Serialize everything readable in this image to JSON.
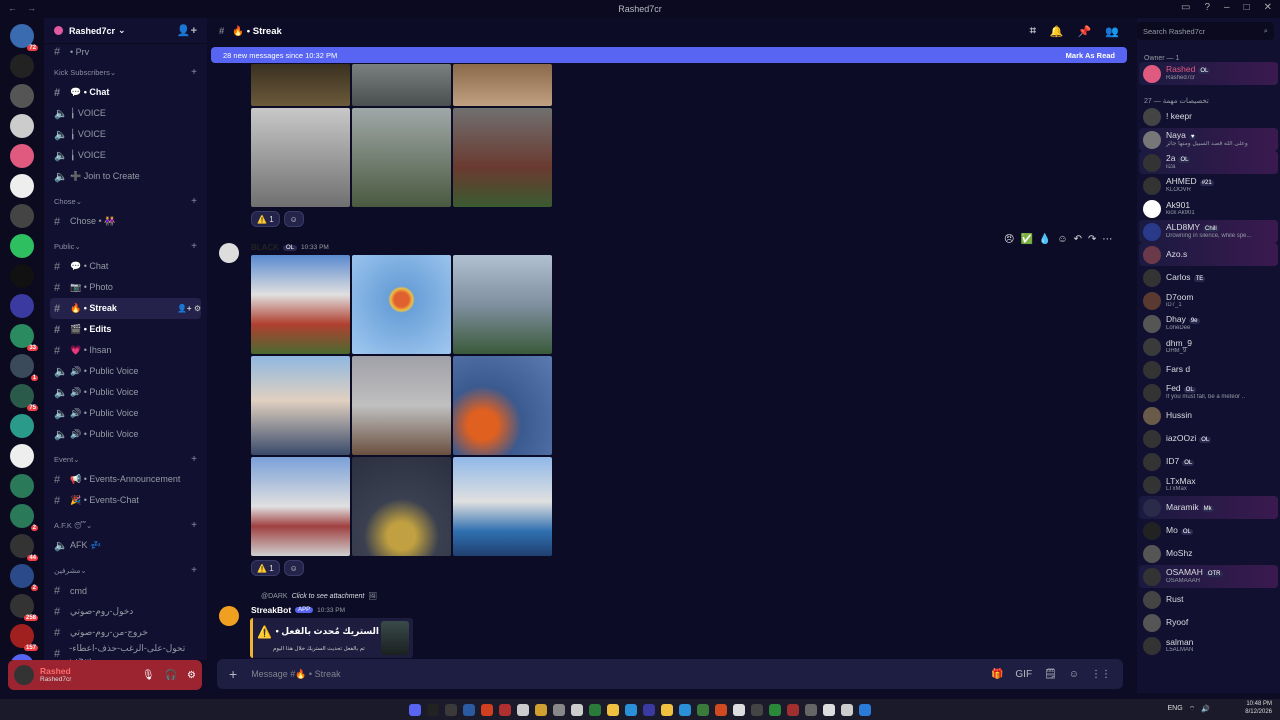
{
  "window": {
    "title": "Rashed7cr",
    "controls": [
      "_",
      "□",
      "×"
    ]
  },
  "server": {
    "name": "Rashed7cr"
  },
  "sidebar": {
    "top_channel": "• Prv",
    "categories": [
      {
        "name": "Kick Subscribers",
        "channels": [
          {
            "icon": "#",
            "label": "💬 • Chat",
            "bold": true
          },
          {
            "icon": "🔊",
            "label": "╽ VOICE"
          },
          {
            "icon": "🔊",
            "label": "╽ VOICE"
          },
          {
            "icon": "🔊",
            "label": "╽ VOICE"
          },
          {
            "icon": "🔊",
            "label": "➕ Join to Create"
          }
        ]
      },
      {
        "name": "Chose",
        "channels": [
          {
            "icon": "#",
            "label": "Chose • 👭"
          }
        ]
      },
      {
        "name": "Public",
        "channels": [
          {
            "icon": "#",
            "label": "💬 • Chat"
          },
          {
            "icon": "#",
            "label": "📷 • Photo"
          },
          {
            "icon": "#",
            "label": "🔥 • Streak",
            "selected": true
          },
          {
            "icon": "#",
            "label": "🎬 • Edits",
            "bold": true
          },
          {
            "icon": "#",
            "label": "💗 • Ihsan"
          },
          {
            "icon": "🔊",
            "label": "🔊 • Public Voice"
          },
          {
            "icon": "🔊",
            "label": "🔊 • Public Voice"
          },
          {
            "icon": "🔊",
            "label": "🔊 • Public Voice"
          },
          {
            "icon": "🔊",
            "label": "🔊 • Public Voice"
          }
        ]
      },
      {
        "name": "Event",
        "channels": [
          {
            "icon": "#",
            "label": "📢 • Events-Announcement"
          },
          {
            "icon": "#",
            "label": "🎉 • Events-Chat"
          }
        ]
      },
      {
        "name": "A.F.K 😴",
        "channels": [
          {
            "icon": "🔊",
            "label": "AFK 💤"
          }
        ]
      },
      {
        "name": "مشرفين",
        "channels": [
          {
            "icon": "#",
            "label": "cmd"
          },
          {
            "icon": "#",
            "label": "دخول-روم-صوتي"
          },
          {
            "icon": "#",
            "label": "خروج-من-روم-صوتي"
          },
          {
            "icon": "#",
            "label": "تحول-على-الرغب-حذف-اعطاء-سحب"
          }
        ]
      }
    ]
  },
  "user_panel": {
    "name": "Rashed",
    "status": "Rashed7cr"
  },
  "channel_header": {
    "name": "🔥 • Streak"
  },
  "banner": {
    "text": "28 new messages since 10:32 PM",
    "action": "Mark As Read"
  },
  "messages": [
    {
      "reaction": "⚠️",
      "count": "1"
    },
    {
      "author": "BLACK",
      "badge": "OL",
      "time": "10:33 PM",
      "reaction": "⚠️",
      "count": "1"
    },
    {
      "reply_to": "@DARK",
      "reply_text": "Click to see attachment",
      "author": "StreakBot",
      "tag": "APP",
      "time": "10:33 PM",
      "embed_title": "الستريك مُحدث بالفعل •",
      "embed_text": "تم بالفعل تحديث الستريك خلال هذا اليوم"
    }
  ],
  "composer": {
    "placeholder": "Message #🔥 • Streak"
  },
  "members": {
    "search": "Search Rashed7cr",
    "groups": [
      {
        "title": "Owner — 1",
        "items": [
          {
            "name": "Rashed",
            "sub": "Rashed7cr",
            "tag": "OL"
          }
        ]
      },
      {
        "title": "27 — تخصيصات مهمة",
        "items": [
          {
            "name": "! keepr",
            "sub": ""
          },
          {
            "name": "Naya",
            "sub": "وعلى الله قصد السبيل ومنها جائر",
            "tag": "♥"
          },
          {
            "name": "2a",
            "sub": "ii2a",
            "tag": "OL"
          },
          {
            "name": "AHMED",
            "sub": "KLOOVR",
            "tag": "#21"
          },
          {
            "name": "Ak901",
            "sub": "kick Ak901"
          },
          {
            "name": "ALD8MY",
            "sub": "Drowning in silence, while spe...",
            "tag": "Chill"
          },
          {
            "name": "Azo.s",
            "sub": ""
          },
          {
            "name": "Carlos",
            "sub": "",
            "tag": "TE"
          },
          {
            "name": "D7oom",
            "sub": "iD7_1"
          },
          {
            "name": "Dhay",
            "sub": "LoneDee",
            "tag": "9e"
          },
          {
            "name": "dhm_9",
            "sub": "DHM_9"
          },
          {
            "name": "Fars d",
            "sub": ""
          },
          {
            "name": "Fed",
            "sub": "If you must fall, be a meteor ..",
            "tag": "OL"
          },
          {
            "name": "Hussin",
            "sub": ""
          },
          {
            "name": "iazOOzi",
            "sub": "",
            "tag": "OL"
          },
          {
            "name": "ID7",
            "sub": "",
            "tag": "OL"
          },
          {
            "name": "LTxMax",
            "sub": "LTxMax"
          },
          {
            "name": "Maramik",
            "sub": "",
            "tag": "Mk"
          },
          {
            "name": "Mo",
            "sub": "",
            "tag": "OL"
          },
          {
            "name": "MoShz",
            "sub": ""
          },
          {
            "name": "OSAMAH",
            "sub": "OSAMAAAH",
            "tag": "OTR"
          },
          {
            "name": "Rust",
            "sub": ""
          },
          {
            "name": "Ryoof",
            "sub": ""
          },
          {
            "name": "salman",
            "sub": "L5ALMAN"
          }
        ]
      }
    ]
  },
  "taskbar": {
    "lang": "ENG",
    "time": "10:48 PM",
    "date": "8/12/2026"
  },
  "colors": {
    "accent": "#5865f2",
    "bg": "#0d0c26",
    "sidebar": "#121031",
    "danger": "#f23f43"
  }
}
